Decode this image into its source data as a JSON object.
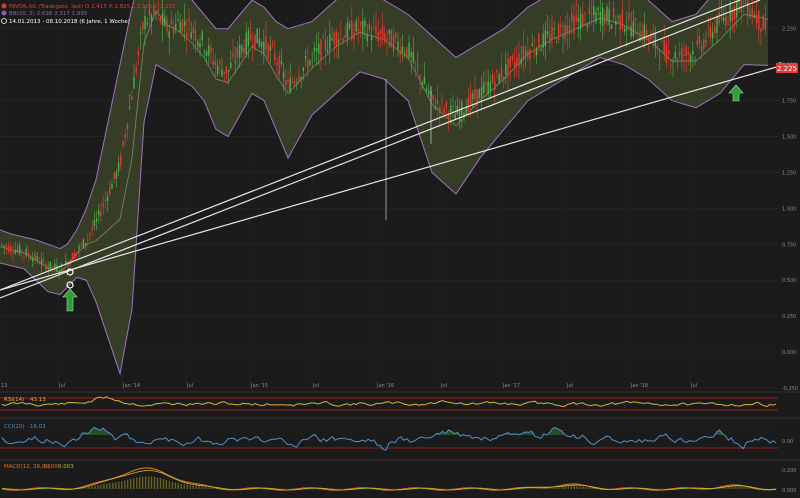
{
  "header": {
    "line1": "FAVOR.AG (Tradegate, last)  O 2.415  H 2.825  L 2.100  C 2.225",
    "line2": "BB(20, 2)  2.638  2.317  1.995",
    "line3": "14.01.2013 - 08.10.2018  (6 Jahre, 1 Woche)"
  },
  "price_label": "2.225",
  "colors": {
    "background": "#1b1b1b",
    "candle_up": "#4caf50",
    "candle_down": "#e53935",
    "band_fill": "#4a5a30",
    "band_edge": "#a070c0",
    "trendline": "#e6e6e6",
    "rsi": "#e0b030",
    "cci": "#4f8fd0",
    "macd": "#e07020",
    "signal": "#c0c020",
    "zero_line": "#c02020",
    "arrow": "#2e9e3a"
  },
  "panels": {
    "rsi": {
      "label": "RSI(14)",
      "value": "43.13"
    },
    "cci": {
      "label": "CCI(20)",
      "value": "-16.02"
    },
    "macd": {
      "label": "MACD(12, 26, 9)",
      "value1": "0.000",
      "value2": "0.003"
    }
  },
  "chart_data": {
    "type": "line",
    "y_ticks": [
      "2.250",
      "2.000",
      "1.750",
      "1.500",
      "1.250",
      "1.000",
      "0.750",
      "0.500",
      "0.250",
      "0.000",
      "-0.250"
    ],
    "x_ticks": [
      "13",
      "Jul",
      "Jan '14",
      "Jul",
      "Jan '15",
      "Jul",
      "Jan '16",
      "Jul",
      "Jan '17",
      "Jul",
      "Jan '18",
      "Jul"
    ],
    "ylim": [
      -0.25,
      2.45
    ],
    "series": [
      {
        "x": [
          0,
          5,
          10,
          15,
          20,
          25,
          28,
          32,
          36,
          40,
          45,
          50,
          55,
          60,
          65,
          70,
          75,
          80,
          85,
          90,
          95,
          100,
          105,
          110,
          115,
          120,
          130,
          140,
          150,
          160,
          170,
          180,
          190,
          200,
          210,
          220,
          230,
          240,
          250,
          260,
          270,
          280,
          290,
          300,
          310,
          320
        ],
        "values": [
          0.75,
          0.72,
          0.7,
          0.65,
          0.6,
          0.58,
          0.62,
          0.7,
          0.78,
          0.9,
          1.1,
          1.3,
          1.8,
          2.3,
          2.35,
          2.25,
          2.3,
          2.25,
          2.15,
          2.0,
          1.95,
          2.1,
          2.2,
          2.15,
          2.05,
          1.85,
          2.05,
          2.2,
          2.25,
          2.2,
          2.1,
          1.75,
          1.65,
          1.8,
          1.95,
          2.1,
          2.2,
          2.3,
          2.35,
          2.3,
          2.2,
          2.05,
          2.1,
          2.3,
          2.45,
          2.225
        ]
      }
    ],
    "bands": {
      "upper": [
        0.85,
        0.82,
        0.8,
        0.78,
        0.75,
        0.72,
        0.75,
        0.85,
        1.0,
        1.2,
        1.6,
        2.0,
        2.4,
        2.7,
        2.75,
        2.6,
        2.55,
        2.45,
        2.35,
        2.25,
        2.25,
        2.35,
        2.45,
        2.4,
        2.3,
        2.25,
        2.3,
        2.45,
        2.5,
        2.45,
        2.35,
        2.2,
        2.05,
        2.15,
        2.25,
        2.4,
        2.5,
        2.55,
        2.6,
        2.55,
        2.45,
        2.3,
        2.35,
        2.55,
        2.7,
        2.638
      ],
      "lower": [
        0.62,
        0.6,
        0.58,
        0.5,
        0.42,
        0.4,
        0.45,
        0.52,
        0.5,
        0.35,
        0.1,
        -0.15,
        0.3,
        1.6,
        2.0,
        1.95,
        1.9,
        1.85,
        1.75,
        1.55,
        1.5,
        1.65,
        1.8,
        1.75,
        1.55,
        1.35,
        1.65,
        1.8,
        1.95,
        1.9,
        1.75,
        1.25,
        1.1,
        1.35,
        1.55,
        1.75,
        1.85,
        1.95,
        2.05,
        2.0,
        1.9,
        1.75,
        1.7,
        1.8,
        2.0,
        1.995
      ]
    }
  }
}
